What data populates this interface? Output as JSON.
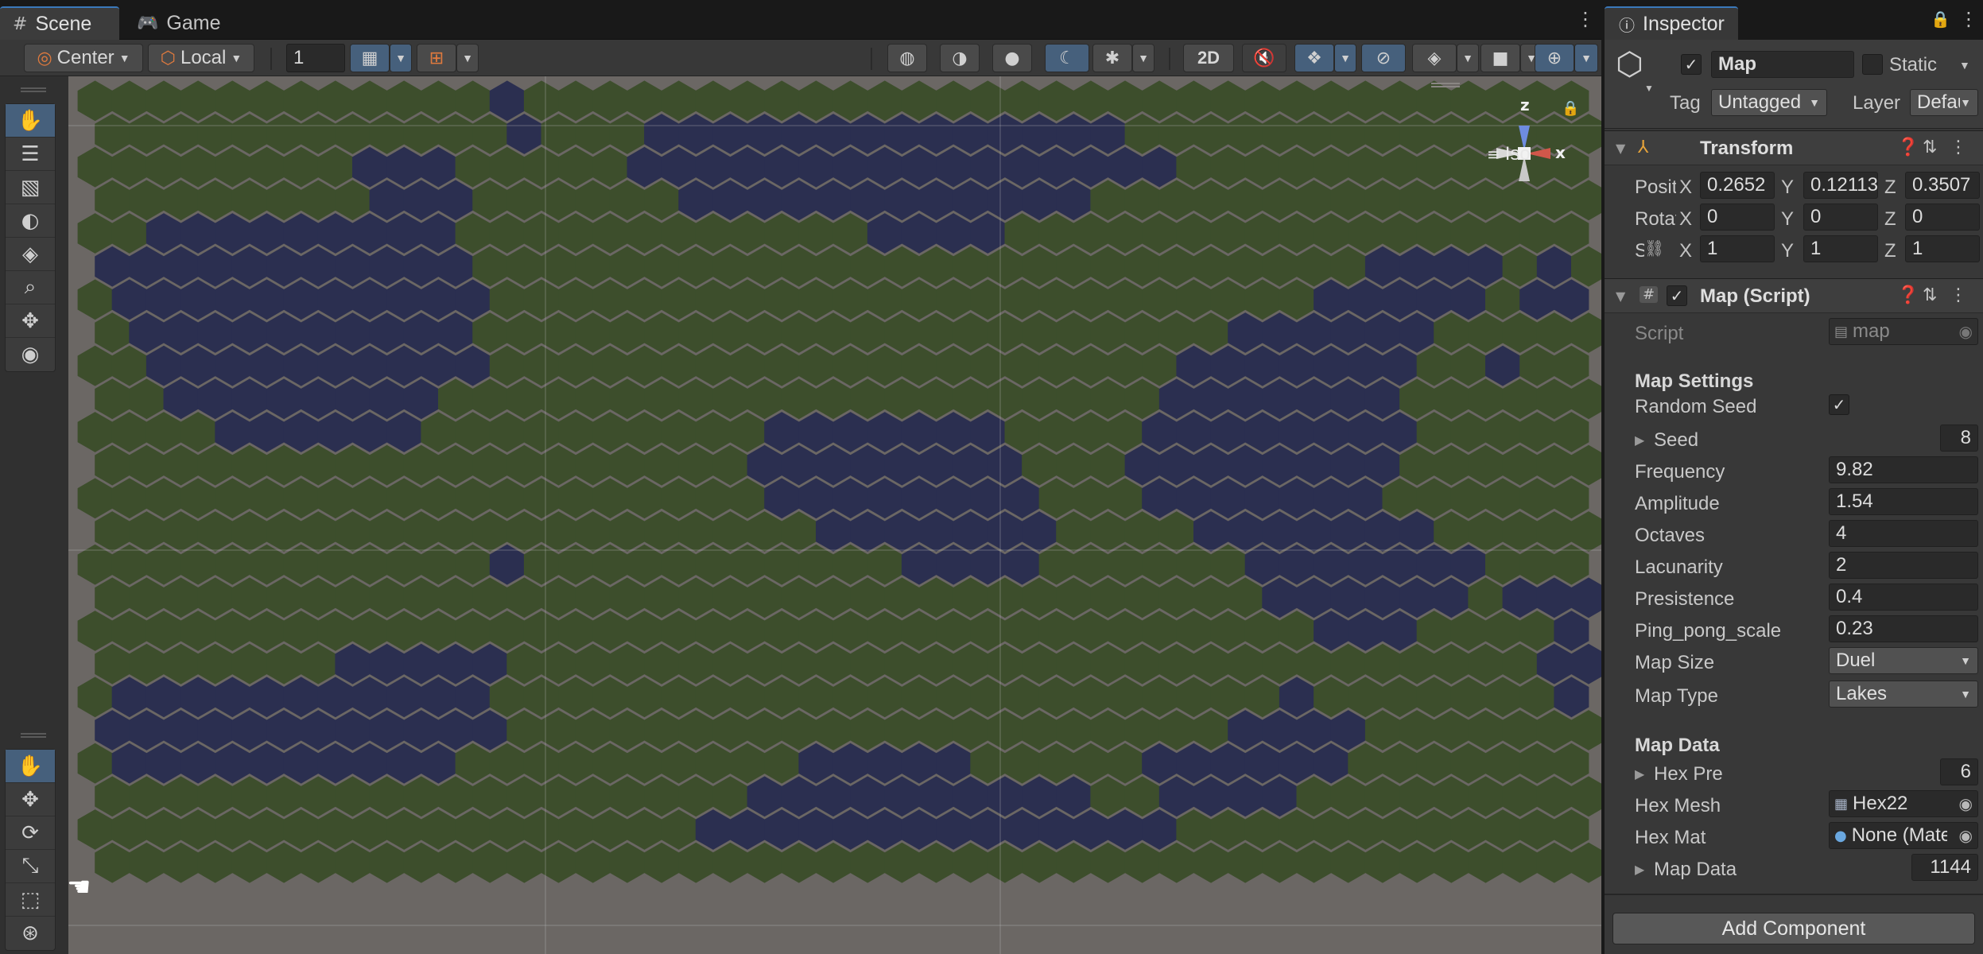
{
  "scene_panel": {
    "tabs": [
      {
        "label": "Scene",
        "icon": "grid-icon"
      },
      {
        "label": "Game",
        "icon": "gamepad-icon"
      }
    ],
    "toolbar": {
      "pivot_mode": "Center",
      "pivot_rotation": "Local",
      "grid_snap_value": "1",
      "mode_2d": "2D"
    },
    "view_gizmo": {
      "axis_z": "z",
      "axis_x": "x",
      "projection": "Iso"
    },
    "map": {
      "grid_columns": 44,
      "grid_rows": 24,
      "land_color": "#3d4e2c",
      "water_color": "#2b2f50",
      "background_color": "#6b6764"
    }
  },
  "inspector": {
    "tab_label": "Inspector",
    "gameobject": {
      "active": true,
      "name": "Map",
      "static_label": "Static",
      "static": false,
      "tag_label": "Tag",
      "tag_value": "Untagged",
      "layer_label": "Layer",
      "layer_value": "Default"
    },
    "transform": {
      "title": "Transform",
      "position_label": "Position",
      "rotation_label": "Rotation",
      "scale_label": "Scale",
      "position": {
        "x": "0.2652",
        "y": "0.12113",
        "z": "0.3507"
      },
      "rotation": {
        "x": "0",
        "y": "0",
        "z": "0"
      },
      "scale": {
        "x": "1",
        "y": "1",
        "z": "1"
      }
    },
    "map_script": {
      "title": "Map (Script)",
      "enabled": true,
      "script_label": "Script",
      "script_value": "map",
      "settings_header": "Map Settings",
      "random_seed_label": "Random Seed",
      "random_seed": true,
      "seed_label": "Seed",
      "seed_value": "8",
      "frequency_label": "Frequency",
      "frequency_value": "9.82",
      "amplitude_label": "Amplitude",
      "amplitude_value": "1.54",
      "octaves_label": "Octaves",
      "octaves_value": "4",
      "lacunarity_label": "Lacunarity",
      "lacunarity_value": "2",
      "persistence_label": "Presistence",
      "persistence_value": "0.4",
      "ping_pong_label": "Ping_pong_scale",
      "ping_pong_value": "0.23",
      "map_size_label": "Map Size",
      "map_size_value": "Duel",
      "map_type_label": "Map Type",
      "map_type_value": "Lakes",
      "data_header": "Map Data",
      "hex_pre_label": "Hex Pre",
      "hex_pre_value": "6",
      "hex_mesh_label": "Hex Mesh",
      "hex_mesh_value": "Hex22",
      "hex_mat_label": "Hex Mat",
      "hex_mat_value": "None (Material)",
      "map_data_label": "Map Data",
      "map_data_value": "1144"
    },
    "add_component_label": "Add Component"
  }
}
